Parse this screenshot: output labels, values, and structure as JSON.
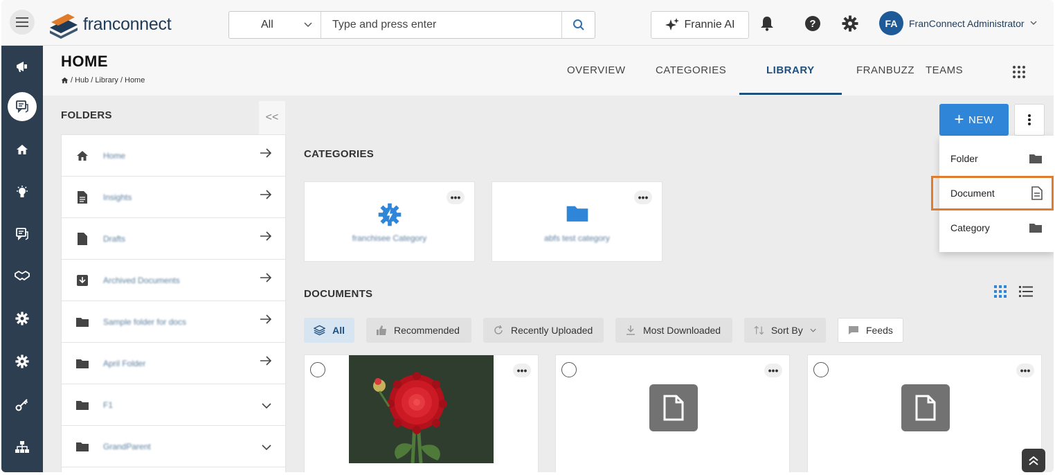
{
  "topbar": {
    "brand": "franconnect",
    "search": {
      "scope": "All",
      "placeholder": "Type and press enter"
    },
    "frannie_label": "Frannie AI",
    "user": {
      "initials": "FA",
      "name": "FranConnect Administrator"
    }
  },
  "page": {
    "title": "HOME",
    "breadcrumb": [
      "Hub",
      "Library",
      "Home"
    ],
    "breadcrumb_sep": "/",
    "tabs": [
      {
        "label": "OVERVIEW",
        "active": false
      },
      {
        "label": "CATEGORIES",
        "active": false
      },
      {
        "label": "LIBRARY",
        "active": true
      },
      {
        "label": "FRANBUZZ",
        "active": false
      },
      {
        "label": "TEAMS",
        "active": false
      }
    ]
  },
  "folders": {
    "heading": "FOLDERS",
    "collapse_label": "<<",
    "items": [
      {
        "name": "Home",
        "icon": "home-icon",
        "action": "arrow-right-icon"
      },
      {
        "name": "Insights",
        "icon": "document-icon",
        "action": "arrow-right-icon"
      },
      {
        "name": "Drafts",
        "icon": "draft-icon",
        "action": "arrow-right-icon"
      },
      {
        "name": "Archived Documents",
        "icon": "archive-icon",
        "action": "arrow-right-icon"
      },
      {
        "name": "Sample folder for docs",
        "icon": "folder-icon",
        "action": "arrow-right-icon"
      },
      {
        "name": "April Folder",
        "icon": "folder-icon",
        "action": "arrow-right-icon"
      },
      {
        "name": "F1",
        "icon": "folder-icon",
        "action": "chevron-down-icon"
      },
      {
        "name": "GrandParent",
        "icon": "folder-icon",
        "action": "chevron-down-icon"
      }
    ]
  },
  "categories": {
    "heading": "CATEGORIES",
    "items": [
      {
        "name": "franchisee Category",
        "icon": "gear-bolt-icon",
        "more": "•••"
      },
      {
        "name": "abfs test category",
        "icon": "folder-icon",
        "more": "•••"
      }
    ]
  },
  "documents": {
    "heading": "DOCUMENTS",
    "filters": [
      {
        "label": "All",
        "icon": "layers-icon",
        "active": true
      },
      {
        "label": "Recommended",
        "icon": "thumbs-up-icon",
        "active": false
      },
      {
        "label": "Recently Uploaded",
        "icon": "refresh-icon",
        "active": false
      },
      {
        "label": "Most Downloaded",
        "icon": "download-icon",
        "active": false
      },
      {
        "label": "Sort By",
        "icon": "sort-icon",
        "active": false
      },
      {
        "label": "Feeds",
        "icon": "feeds-icon",
        "active": false
      }
    ],
    "cards": [
      {
        "kind": "image",
        "more": "•••"
      },
      {
        "kind": "file",
        "more": "•••"
      },
      {
        "kind": "file",
        "more": "•••"
      }
    ]
  },
  "actions": {
    "new_label": "NEW",
    "new_plus": "+",
    "menu": [
      {
        "label": "Folder",
        "icon": "folder-icon",
        "highlighted": false
      },
      {
        "label": "Document",
        "icon": "document-icon",
        "highlighted": true
      },
      {
        "label": "Category",
        "icon": "folder-icon",
        "highlighted": false
      }
    ]
  },
  "colors": {
    "rail": "#2d3e50",
    "accent": "#2f86d8",
    "active_tab": "#1f4f7d",
    "highlight": "#e07b2a"
  }
}
